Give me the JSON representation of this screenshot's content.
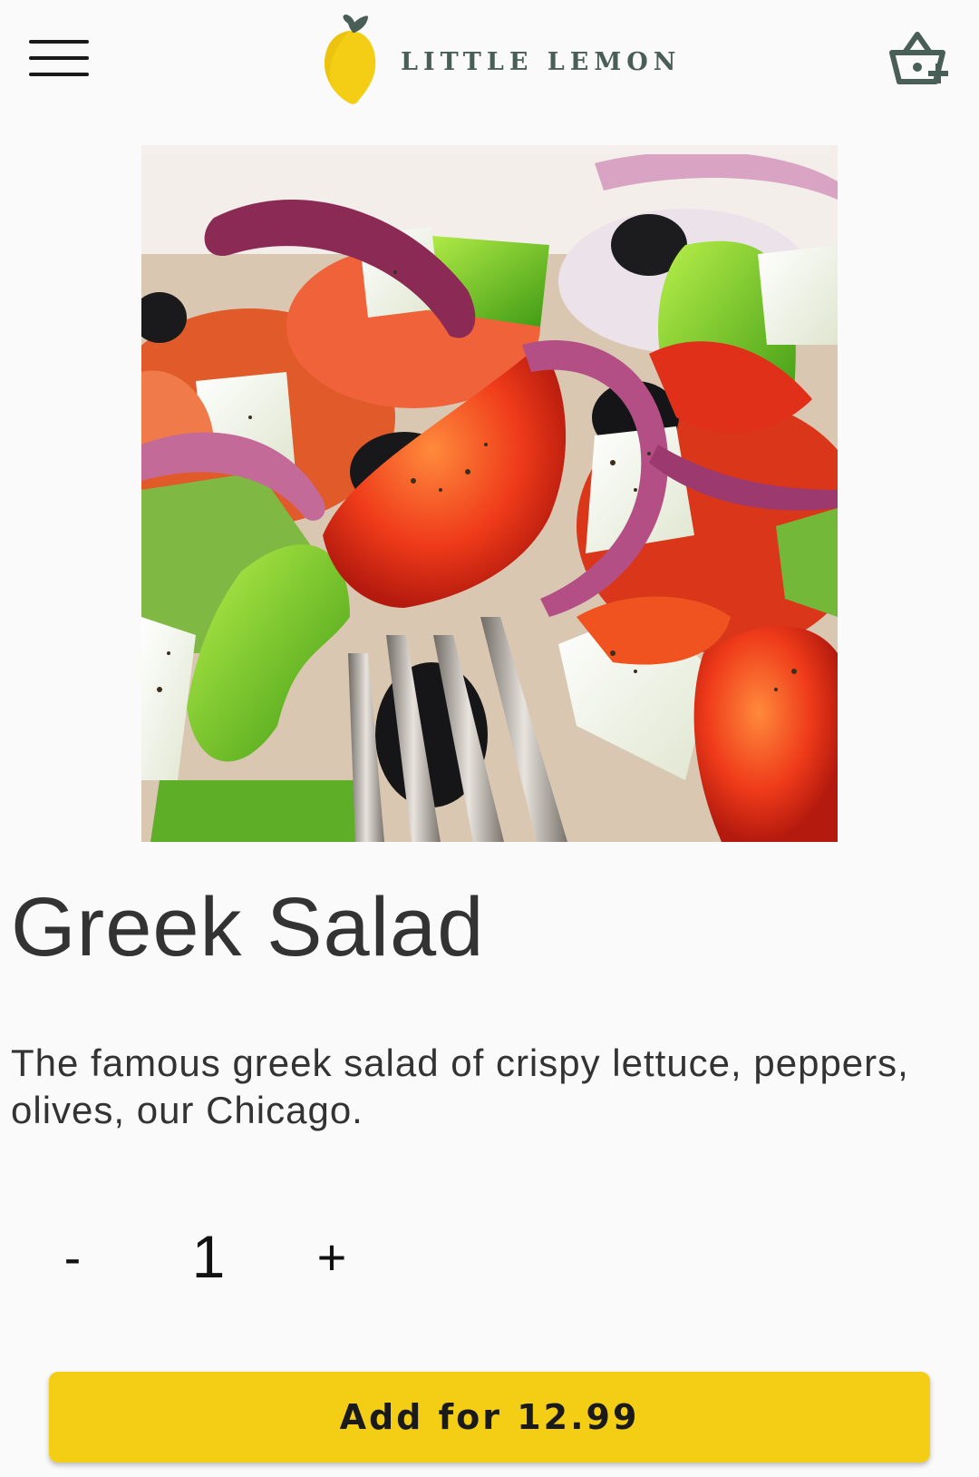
{
  "app": {
    "brand_name": "LITTLE LEMON",
    "brand_color": "#495e57",
    "accent_color": "#f4ce14"
  },
  "header": {
    "menu_icon": "hamburger-menu-icon",
    "logo_icon": "lemon-logo-icon",
    "cart_icon": "basket-add-icon"
  },
  "dish": {
    "image": "greek-salad-photo",
    "title": "Greek Salad",
    "description": "The famous greek salad of crispy lettuce, peppers, olives, our Chicago."
  },
  "quantity": {
    "minus_label": "-",
    "value": "1",
    "plus_label": "+"
  },
  "actions": {
    "add_label": "Add for 12.99"
  }
}
